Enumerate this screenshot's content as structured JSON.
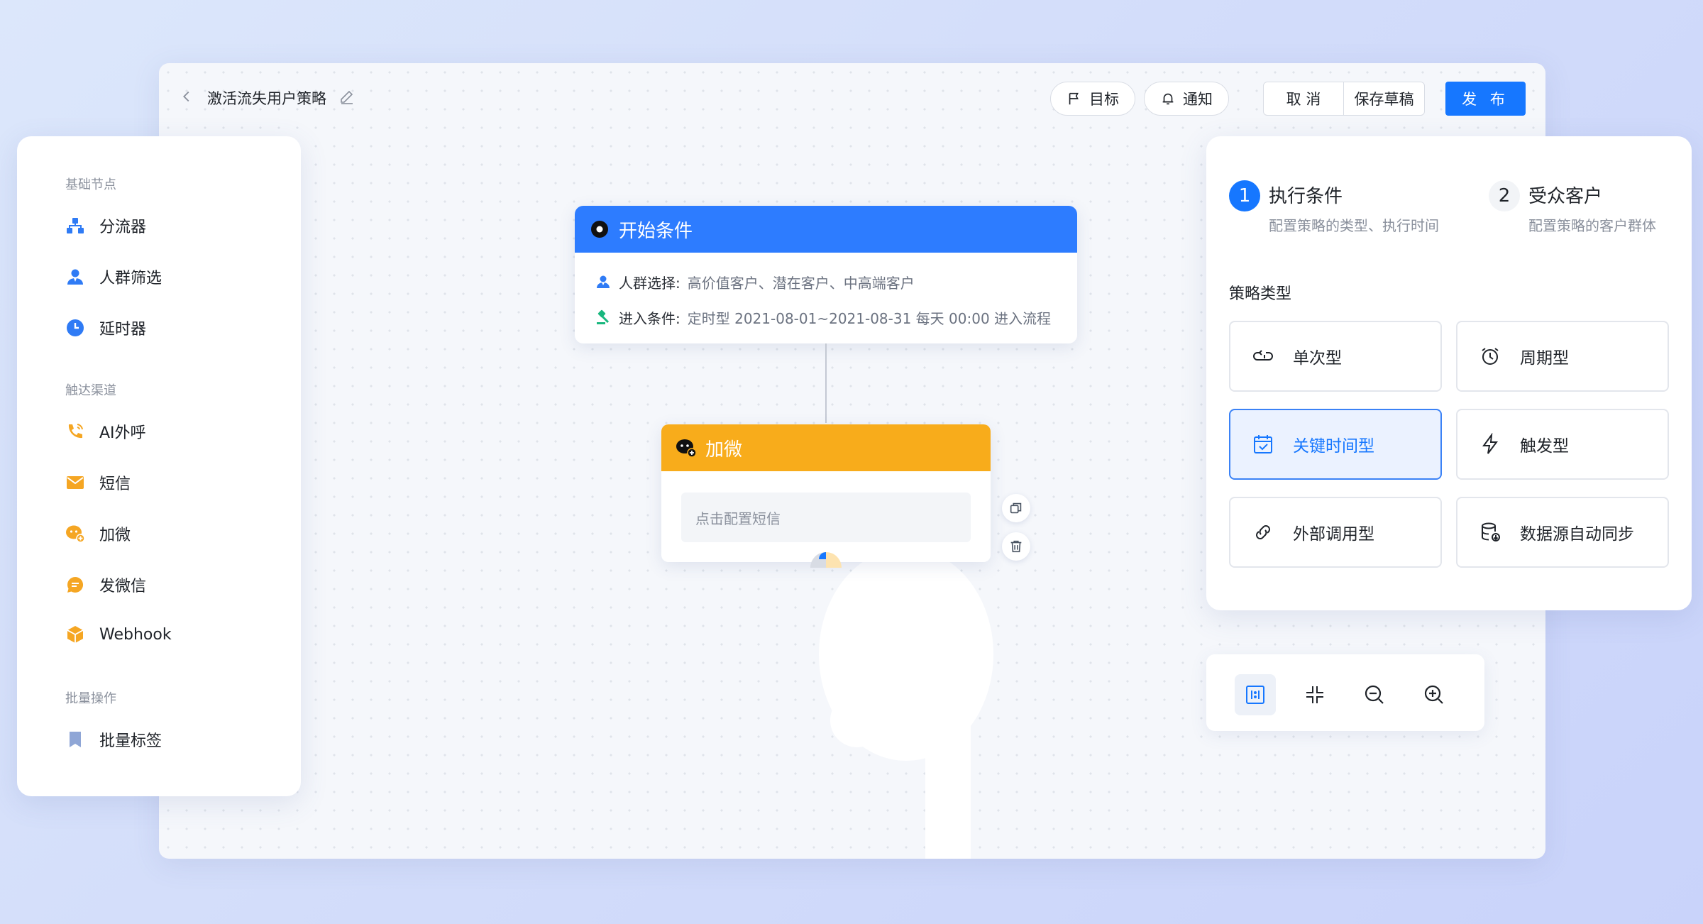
{
  "header": {
    "title": "激活流失用户策略",
    "goal_label": "目标",
    "notify_label": "通知",
    "cancel_label": "取 消",
    "save_draft_label": "保存草稿",
    "publish_label": "发 布"
  },
  "sidebar": {
    "sections": [
      {
        "title": "基础节点",
        "items": [
          {
            "label": "分流器",
            "icon": "splitter-icon"
          },
          {
            "label": "人群筛选",
            "icon": "crowd-filter-icon"
          },
          {
            "label": "延时器",
            "icon": "clock-icon"
          }
        ]
      },
      {
        "title": "触达渠道",
        "items": [
          {
            "label": "AI外呼",
            "icon": "phone-icon"
          },
          {
            "label": "短信",
            "icon": "mail-icon"
          },
          {
            "label": "加微",
            "icon": "wechat-add-icon"
          },
          {
            "label": "发微信",
            "icon": "chat-icon"
          },
          {
            "label": "Webhook",
            "icon": "webhook-icon"
          }
        ]
      },
      {
        "title": "批量操作",
        "items": [
          {
            "label": "批量标签",
            "icon": "bookmark-icon"
          }
        ]
      }
    ]
  },
  "canvas": {
    "start_node": {
      "title": "开始条件",
      "crowd_label": "人群选择:",
      "crowd_value": "高价值客户、潜在客户、中高端客户",
      "entry_label": "进入条件:",
      "entry_value": "定时型 2021-08-01~2021-08-31 每天 00:00 进入流程"
    },
    "wechat_node": {
      "title": "加微",
      "placeholder": "点击配置短信"
    }
  },
  "config_panel": {
    "steps": [
      {
        "num": "1",
        "title": "执行条件",
        "subtitle": "配置策略的类型、执行时间",
        "active": true
      },
      {
        "num": "2",
        "title": "受众客户",
        "subtitle": "配置策略的客户群体",
        "active": false
      }
    ],
    "strategy_type_label": "策略类型",
    "options": [
      {
        "label": "单次型",
        "icon": "single-run-icon",
        "active": false
      },
      {
        "label": "周期型",
        "icon": "alarm-clock-icon",
        "active": false
      },
      {
        "label": "关键时间型",
        "icon": "calendar-check-icon",
        "active": true
      },
      {
        "label": "触发型",
        "icon": "lightning-icon",
        "active": false
      },
      {
        "label": "外部调用型",
        "icon": "link-icon",
        "active": false
      },
      {
        "label": "数据源自动同步",
        "icon": "database-sync-icon",
        "active": false
      }
    ]
  },
  "zoom_controls": [
    "fit-view-icon",
    "collapse-icon",
    "zoom-out-icon",
    "zoom-in-icon"
  ],
  "colors": {
    "primary": "#1677ff",
    "start_header": "#2d7cff",
    "wechat_header": "#f8ac1b",
    "icon_blue": "#2f7bf5",
    "icon_orange": "#f5a623",
    "icon_green": "#19b77e"
  }
}
